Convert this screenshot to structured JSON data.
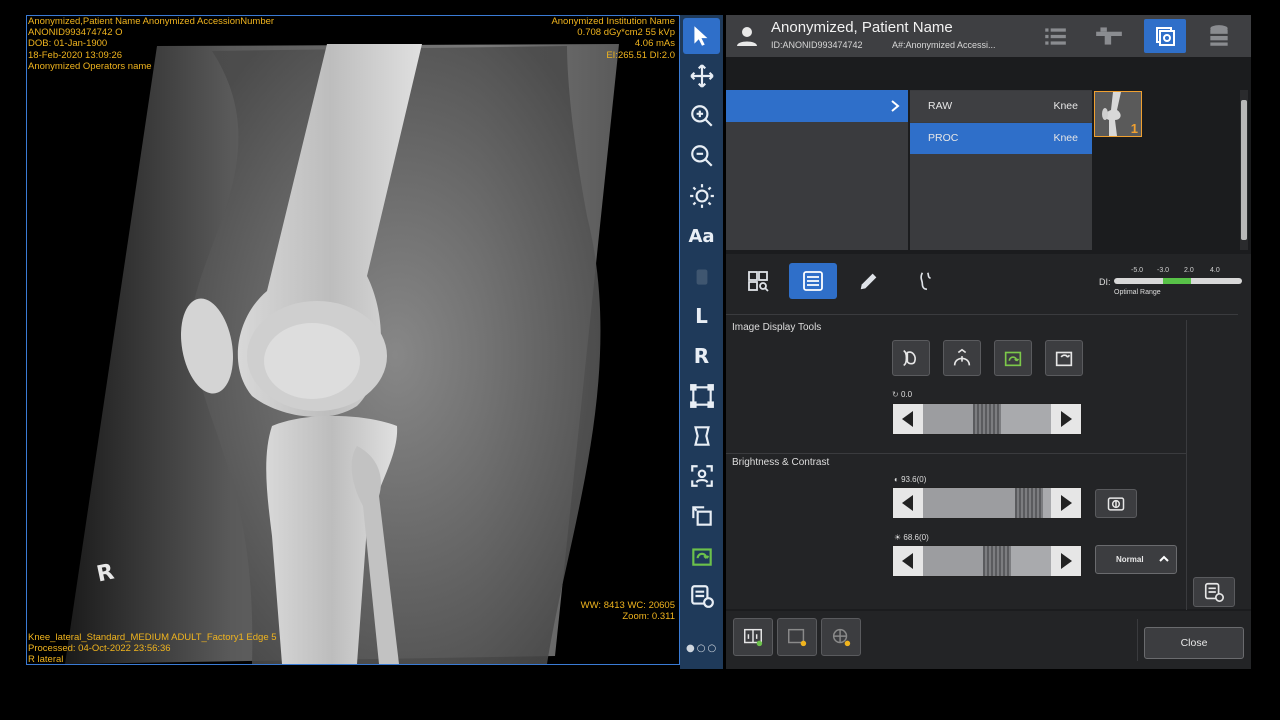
{
  "viewer": {
    "overlay_tl": [
      "Anonymized,Patient Name Anonymized AccessionNumber",
      "ANONID993474742 O",
      "DOB: 01-Jan-1900",
      "18-Feb-2020   13:09:26",
      "Anonymized Operators name"
    ],
    "overlay_tr": [
      "Anonymized Institution Name",
      "0.708 dGy*cm2   55 kVp",
      "4.06 mAs",
      "EI:265.51 DI:2.0"
    ],
    "overlay_br": [
      "WW: 8413 WC: 20605",
      "Zoom: 0.311"
    ],
    "overlay_bl": [
      "Knee_lateral_Standard_MEDIUM ADULT_Factory1 Edge 5",
      "Processed: 04-Oct-2022  23:56:36",
      "R lateral"
    ],
    "side_marker": "R"
  },
  "toolbar": {
    "items": [
      {
        "name": "pointer-icon"
      },
      {
        "name": "pan-icon"
      },
      {
        "name": "zoom-in-icon"
      },
      {
        "name": "zoom-out-icon"
      },
      {
        "name": "brightness-icon"
      },
      {
        "name": "annotation-text-icon",
        "label": "Aa"
      },
      {
        "name": "disabled-icon"
      },
      {
        "name": "marker-L",
        "label": "L"
      },
      {
        "name": "marker-R",
        "label": "R"
      },
      {
        "name": "crop-icon"
      },
      {
        "name": "shutter-icon"
      },
      {
        "name": "roi-icon"
      },
      {
        "name": "rotate-icon"
      },
      {
        "name": "flip-icon"
      },
      {
        "name": "series-tools-icon"
      }
    ],
    "pager": "●○○"
  },
  "patient": {
    "name": "Anonymized, Patient Name",
    "id": "ID:ANONID993474742",
    "accession": "A#:Anonymized Accessi..."
  },
  "series": {
    "rows": [
      {
        "type": "RAW",
        "body": "Knee"
      },
      {
        "type": "PROC",
        "body": "Knee"
      }
    ],
    "thumb_index": "1"
  },
  "di": {
    "ticks": [
      "-5.0",
      "-3.0",
      "2.0",
      "4.0"
    ],
    "label": "DI:",
    "range_label": "Optimal Range"
  },
  "sections": {
    "image_display": "Image Display Tools",
    "brightness_contrast": "Brightness & Contrast"
  },
  "sliders": {
    "rotation": {
      "value_label": "0.0",
      "fraction": 0.5
    },
    "contrast": {
      "value_label": "93.6(0)",
      "fraction": 0.92
    },
    "brightness": {
      "value_label": "68.6(0)",
      "fraction": 0.6
    }
  },
  "buttons": {
    "normal": "Normal",
    "close": "Close"
  },
  "colors": {
    "accent": "#2f6fc9",
    "overlay": "#f0b41e",
    "active_green": "#6cc14b"
  }
}
